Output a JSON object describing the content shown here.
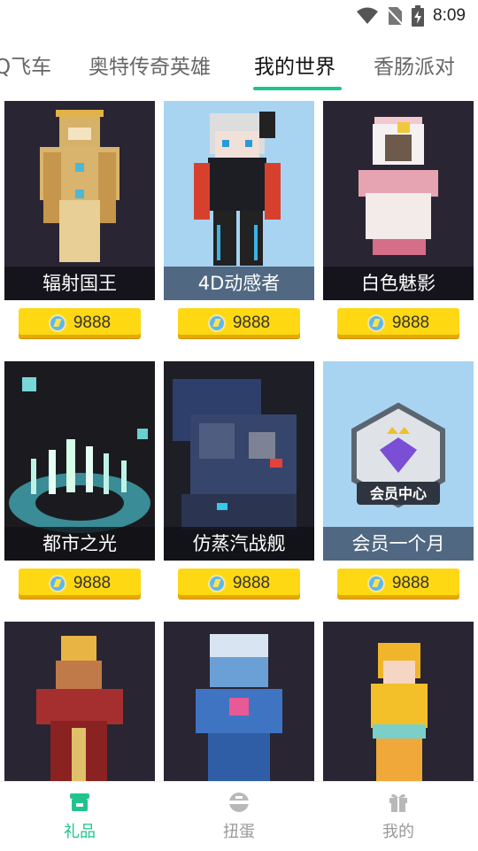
{
  "status": {
    "time": "8:09"
  },
  "tabs": [
    {
      "label": "Q飞车"
    },
    {
      "label": "奥特传奇英雄"
    },
    {
      "label": "我的世界"
    },
    {
      "label": "香肠派对"
    }
  ],
  "items": [
    {
      "name": "辐射国王",
      "price": "9888"
    },
    {
      "name": "4D动感者",
      "price": "9888"
    },
    {
      "name": "白色魅影",
      "price": "9888"
    },
    {
      "name": "都市之光",
      "price": "9888"
    },
    {
      "name": "仿蒸汽战舰",
      "price": "9888"
    },
    {
      "name": "会员一个月",
      "price": "9888",
      "badge": "会员中心"
    },
    {
      "name": "",
      "price": ""
    },
    {
      "name": "",
      "price": ""
    },
    {
      "name": "",
      "price": ""
    }
  ],
  "bottom_nav": [
    {
      "label": "礼品",
      "icon": "shop-icon"
    },
    {
      "label": "扭蛋",
      "icon": "capsule-icon"
    },
    {
      "label": "我的",
      "icon": "gift-icon"
    }
  ],
  "colors": {
    "accent": "#1fc48a",
    "price_button": "#ffd814",
    "label_bg": "#0f0f16"
  }
}
